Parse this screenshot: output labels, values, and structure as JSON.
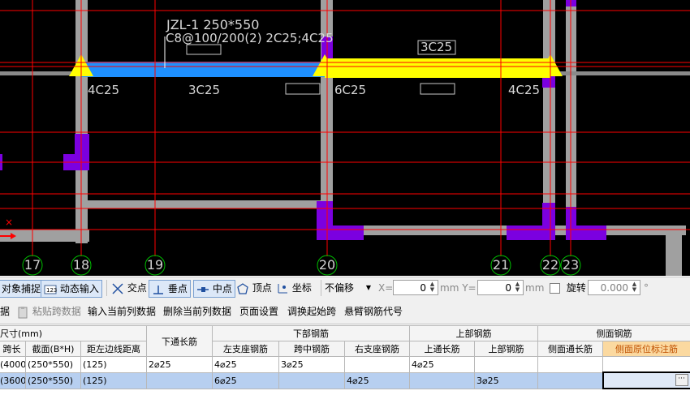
{
  "cad": {
    "beam_label_line1": "JZL-1 250*550",
    "beam_label_line2": "C8@100/200(2) 2C25;4C25",
    "span_top_label": "3C25",
    "bottom_labels": [
      "4C25",
      "3C25",
      "6C25",
      "4C25"
    ],
    "axis_numbers": [
      "17",
      "18",
      "19",
      "20",
      "21",
      "22",
      "23"
    ],
    "colors": {
      "beam_blue": "#1e90ff",
      "beam_yellow": "#ffff00",
      "column": "#7b00e0",
      "wall": "#a0a0a0",
      "axis": "#ff0000"
    }
  },
  "snap": {
    "object_snap": "对象捕捉",
    "dynamic_input": "动态输入",
    "intersection": "交点",
    "perpendicular": "垂点",
    "midpoint": "中点",
    "vertex": "顶点",
    "coordinate": "坐标",
    "offset_mode": "不偏移",
    "x_label": "X=",
    "x_value": "0",
    "y_label": "mm Y=",
    "y_value": "0",
    "mm": "mm",
    "rotate": "旋转",
    "rotate_value": "0.000",
    "degree": "°"
  },
  "toolbar": {
    "data": "据",
    "paste_span": "粘贴跨数据",
    "input_col": "输入当前列数据",
    "delete_col": "删除当前列数据",
    "page_setup": "页面设置",
    "adjust_start": "调换起始跨",
    "cantilever": "悬臂钢筋代号"
  },
  "table": {
    "group_size": "尺寸(mm)",
    "bottom_through": "下通长筋",
    "group_lower": "下部钢筋",
    "group_upper": "上部钢筋",
    "group_side": "侧面钢筋",
    "cols": [
      "跨长",
      "截面(B*H)",
      "距左边线距离",
      "左支座钢筋",
      "跨中钢筋",
      "右支座钢筋",
      "上通长筋",
      "上部钢筋",
      "侧面通长筋",
      "侧面原位标注筋"
    ],
    "rows": [
      [
        "(4000)",
        "(250*550)",
        "(125)",
        "2⌀25",
        "4⌀25",
        "3⌀25",
        "",
        "4⌀25",
        "",
        "",
        ""
      ],
      [
        "(3600)",
        "(250*550)",
        "(125)",
        "",
        "6⌀25",
        "",
        "4⌀25",
        "",
        "3⌀25",
        "",
        ""
      ]
    ]
  }
}
